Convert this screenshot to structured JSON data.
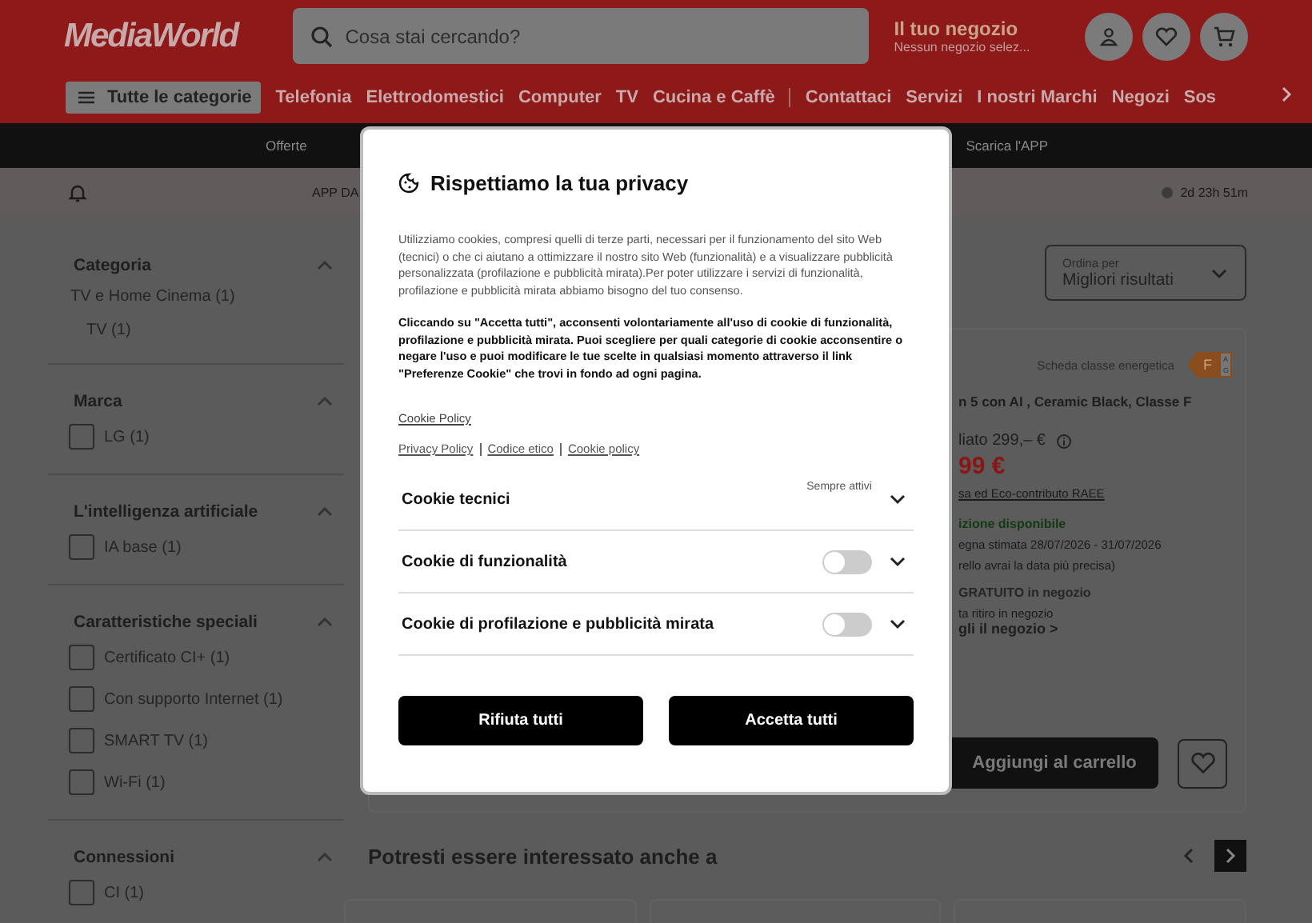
{
  "header": {
    "logo": "MediaWorld",
    "search": {
      "placeholder": "Cosa stai cercando?"
    },
    "store": {
      "title": "Il tuo negozio",
      "subtitle": "Nessun negozio selez..."
    }
  },
  "nav": {
    "categories_button": "Tutte le categorie",
    "links": [
      "Telefonia",
      "Elettrodomestici",
      "Computer",
      "TV",
      "Cucina e Caffè"
    ],
    "secondary_links": [
      "Contattaci",
      "Servizi",
      "I nostri Marchi",
      "Negozi",
      "Sos"
    ]
  },
  "promo_bar": {
    "links": [
      "Offerte",
      "Scarica l'APP"
    ]
  },
  "notice_bar": {
    "text": "APP DA",
    "countdown": "2d 23h 51m"
  },
  "sidebar": {
    "sections": [
      {
        "title": "Categoria",
        "expanded": true,
        "items": [
          {
            "kind": "link",
            "label": "TV e Home Cinema (1)",
            "children": [
              {
                "kind": "link",
                "label": "TV (1)"
              }
            ]
          }
        ]
      },
      {
        "title": "Marca",
        "expanded": true,
        "items": [
          {
            "kind": "checkbox",
            "label": "LG (1)",
            "checked": false
          }
        ]
      },
      {
        "title": "L'intelligenza artificiale",
        "expanded": true,
        "items": [
          {
            "kind": "checkbox",
            "label": "IA base (1)",
            "checked": false
          }
        ]
      },
      {
        "title": "Caratteristiche speciali",
        "expanded": true,
        "items": [
          {
            "kind": "checkbox",
            "label": "Certificato CI+ (1)",
            "checked": false
          },
          {
            "kind": "checkbox",
            "label": "Con supporto Internet (1)",
            "checked": false
          },
          {
            "kind": "checkbox",
            "label": "SMART TV (1)",
            "checked": false
          },
          {
            "kind": "checkbox",
            "label": "Wi-Fi (1)",
            "checked": false
          }
        ]
      },
      {
        "title": "Connessioni",
        "expanded": true,
        "items": [
          {
            "kind": "checkbox",
            "label": "CI (1)",
            "checked": false
          }
        ]
      }
    ]
  },
  "sort": {
    "label": "Ordina per",
    "value": "Migliori risultati"
  },
  "product": {
    "energy_link": "Scheda classe energetica",
    "energy_class": "F",
    "energy_scale": [
      "A",
      "G"
    ],
    "title": "n 5 con AI , Ceramic Black, Classe F",
    "previous_price": "liato 299,– €",
    "price": "99 €",
    "fee_link": "sa ed Eco-contributo RAEE",
    "availability": "izione disponibile",
    "delivery": "egna stimata 28/07/2026 - 31/07/2026",
    "delivery_note": "rello avrai la data più precisa)",
    "pickup": "GRATUITO in negozio",
    "pickup_note": "ta ritiro in negozio",
    "store_link": "gli il negozio >",
    "add_to_cart": "Aggiungi al carrello"
  },
  "recommendations": {
    "title": "Potresti essere interessato anche a"
  },
  "modal": {
    "title": "Rispettiamo la tua privacy",
    "intro": "Utilizziamo cookies, compresi quelli di terze parti, necessari per il funzionamento del sito Web (tecnici) o che ci aiutano a ottimizzare il nostro sito Web (funzionalità) e a visualizzare pubblicità personalizzata (profilazione e pubblicità mirata).Per poter utilizzare i servizi di funzionalità, profilazione e pubblicità mirata abbiamo bisogno del tuo consenso.",
    "notice": "Cliccando su \"Accetta tutti\", acconsenti volontariamente all'uso di cookie di funzionalità, profilazione e pubblicità mirata. Puoi scegliere per quali categorie di cookie acconsentire o negare l'uso e puoi modificare le tue scelte in qualsiasi momento attraverso il link \"Preferenze Cookie\" che trovi in fondo ad ogni pagina.",
    "cookie_policy_link": "Cookie Policy",
    "footer_links": [
      "Privacy Policy",
      "Codice etico",
      "Cookie policy"
    ],
    "categories": [
      {
        "kind": "always",
        "name": "Cookie tecnici",
        "status": "Sempre attivi"
      },
      {
        "kind": "toggle",
        "name": "Cookie di funzionalità",
        "on": false
      },
      {
        "kind": "toggle",
        "name": "Cookie di profilazione e pubblicità mirata",
        "on": false
      }
    ],
    "buttons": [
      "Rifiuta tutti",
      "Accetta tutti"
    ]
  }
}
